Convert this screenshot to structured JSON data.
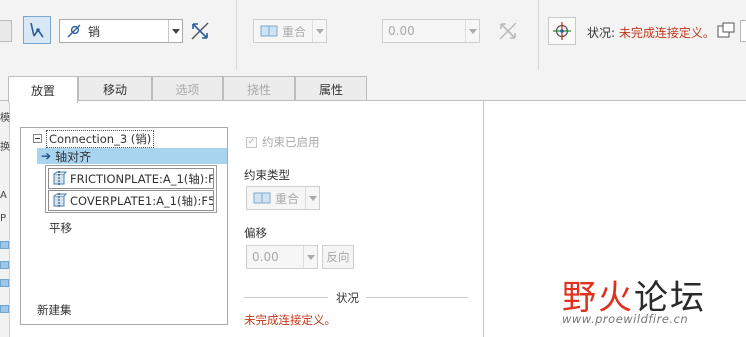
{
  "ribbon": {
    "constraint_type_value": "销",
    "align_combo_value": "重合",
    "offset_value": "0.00",
    "status_label": "状况:",
    "status_value": "未完成连接定义。"
  },
  "tabs": [
    {
      "label": "放置",
      "state": "active"
    },
    {
      "label": "移动",
      "state": "normal"
    },
    {
      "label": "选项",
      "state": "disabled"
    },
    {
      "label": "挠性",
      "state": "disabled"
    },
    {
      "label": "属性",
      "state": "normal"
    }
  ],
  "sliver_fragments": [
    "模",
    "换",
    "A",
    "P"
  ],
  "tree": {
    "root_label": "Connection_3 (销)",
    "selected_item": "轴对齐",
    "references": [
      "FRICTIONPLATE:A_1(轴):F",
      "COVERPLATE1:A_1(轴):F5("
    ],
    "leaf_label": "平移",
    "new_set_label": "新建集"
  },
  "constraint_panel": {
    "enabled_label": "约束已启用",
    "type_label": "约束类型",
    "type_value": "重合",
    "offset_label": "偏移",
    "offset_value": "0.00",
    "flip_label": "反向",
    "status_title": "状况",
    "status_message": "未完成连接定义。"
  },
  "watermark": {
    "part1": "野火",
    "part2": "论坛",
    "url": "www.proewildfire.cn"
  },
  "colors": {
    "status_red": "#c2371a",
    "selection_blue": "#a8d4ef",
    "watermark_red": "#e0301e"
  },
  "icons": {
    "pin_connection": "pin-icon",
    "flip_axis": "flip-arrows-icon",
    "coincident": "coincident-icon",
    "move_component": "move-component-icon",
    "axis_reference": "axis-part-icon"
  }
}
